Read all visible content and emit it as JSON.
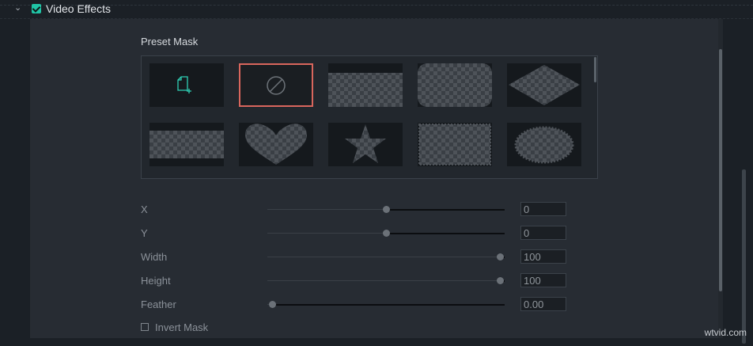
{
  "section": {
    "title": "Video Effects",
    "enabled": true
  },
  "preset_mask": {
    "label": "Preset Mask",
    "tiles": [
      {
        "name": "custom-mask",
        "icon": "add-file-icon"
      },
      {
        "name": "none",
        "icon": "no-symbol-icon",
        "selected": true
      },
      {
        "name": "rectangle-wide"
      },
      {
        "name": "rounded-rectangle"
      },
      {
        "name": "diamond"
      },
      {
        "name": "letterbox"
      },
      {
        "name": "heart"
      },
      {
        "name": "star"
      },
      {
        "name": "stamp-edge"
      },
      {
        "name": "burst-ellipse"
      }
    ]
  },
  "params": [
    {
      "label": "X",
      "value": "0",
      "position": 0.5
    },
    {
      "label": "Y",
      "value": "0",
      "position": 0.5
    },
    {
      "label": "Width",
      "value": "100",
      "position": 1.0
    },
    {
      "label": "Height",
      "value": "100",
      "position": 1.0
    },
    {
      "label": "Feather",
      "value": "0.00",
      "position": 0.0
    }
  ],
  "invert_mask": {
    "label": "Invert Mask",
    "checked": false
  },
  "watermark": "wtvid.com",
  "colors": {
    "accent": "#20c4a6",
    "selected_border": "#d9665d",
    "panel": "#272c33"
  }
}
